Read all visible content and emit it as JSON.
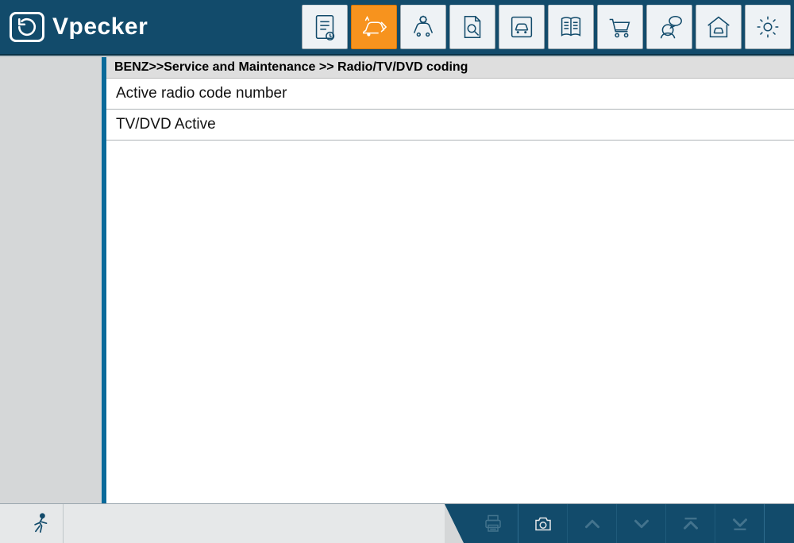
{
  "brand": {
    "name": "Vpecker"
  },
  "toolbar": {
    "items": [
      {
        "name": "report-icon",
        "active": false
      },
      {
        "name": "car-diag-icon",
        "active": true
      },
      {
        "name": "service-icon",
        "active": false
      },
      {
        "name": "lookup-icon",
        "active": false
      },
      {
        "name": "vehicle-icon",
        "active": false
      },
      {
        "name": "manual-icon",
        "active": false
      },
      {
        "name": "shop-icon",
        "active": false
      },
      {
        "name": "feedback-icon",
        "active": false
      },
      {
        "name": "garage-icon",
        "active": false
      },
      {
        "name": "settings-icon",
        "active": false
      }
    ]
  },
  "breadcrumb": "BENZ>>Service and Maintenance >> Radio/TV/DVD coding",
  "menu": {
    "items": [
      {
        "label": "Active radio code number"
      },
      {
        "label": "TV/DVD Active"
      }
    ]
  },
  "footer": {
    "run": "run",
    "buttons": [
      {
        "name": "print-icon",
        "disabled": true
      },
      {
        "name": "camera-icon",
        "disabled": false
      },
      {
        "name": "up-icon",
        "disabled": true
      },
      {
        "name": "down-icon",
        "disabled": true
      },
      {
        "name": "top-icon",
        "disabled": true
      },
      {
        "name": "bottom-icon",
        "disabled": true
      }
    ],
    "back": "back"
  }
}
